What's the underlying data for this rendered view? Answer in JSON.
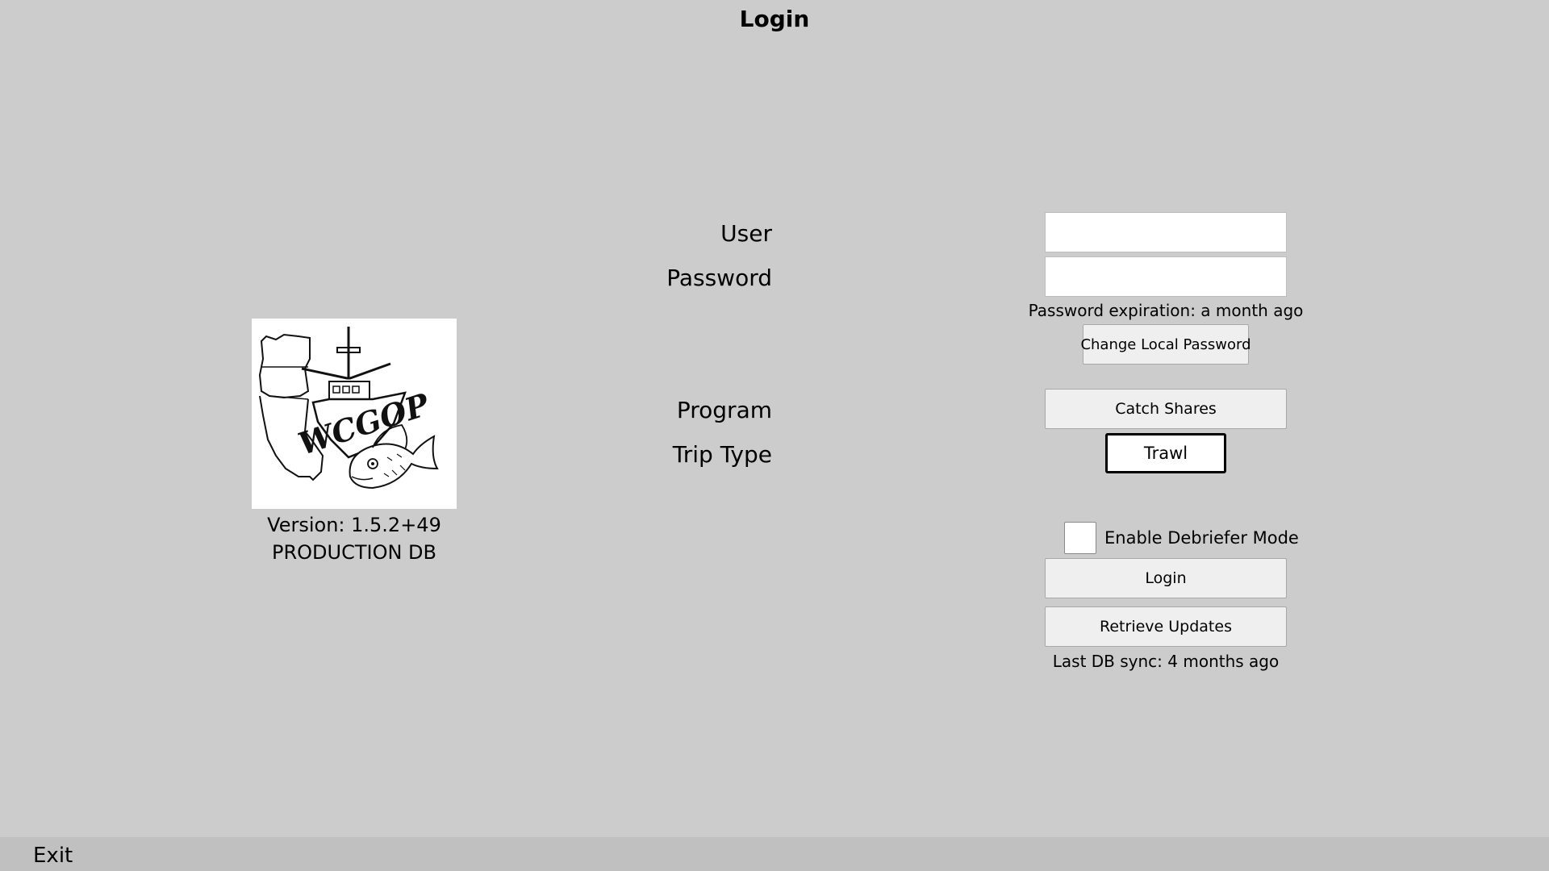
{
  "header": {
    "title": "Login"
  },
  "form": {
    "user_label": "User",
    "user_value": "",
    "password_label": "Password",
    "password_value": "",
    "password_expiration": "Password expiration: a month ago",
    "change_password_label": "Change Local Password",
    "program_label": "Program",
    "program_value": "Catch Shares",
    "trip_type_label": "Trip Type",
    "trip_type_value": "Trawl",
    "debriefer_label": "Enable Debriefer Mode",
    "debriefer_checked": false,
    "login_label": "Login",
    "retrieve_updates_label": "Retrieve Updates",
    "last_sync": "Last DB sync: 4 months ago"
  },
  "logo": {
    "name": "wcgop-logo",
    "text": "WCGOP"
  },
  "app_info": {
    "version": "Version: 1.5.2+49",
    "database": "PRODUCTION DB"
  },
  "footer": {
    "exit_label": "Exit"
  }
}
